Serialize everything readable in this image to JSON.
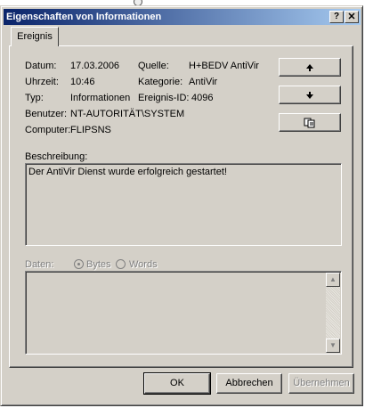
{
  "window": {
    "title": "Eigenschaften von Informationen",
    "help_glyph": "?",
    "close_glyph": "✕"
  },
  "tab": {
    "label": "Ereignis"
  },
  "fields": {
    "datum_label": "Datum:",
    "datum_value": "17.03.2006",
    "quelle_label": "Quelle:",
    "quelle_value": "H+BEDV AntiVir",
    "uhrzeit_label": "Uhrzeit:",
    "uhrzeit_value": "10:46",
    "kategorie_label": "Kategorie:",
    "kategorie_value": "AntiVir",
    "typ_label": "Typ:",
    "typ_value": "Informationen",
    "ereignis_id_label": "Ereignis-ID:",
    "ereignis_id_value": "4096",
    "benutzer_label": "Benutzer:",
    "benutzer_value": "NT-AUTORITÄT\\SYSTEM",
    "computer_label": "Computer:",
    "computer_value": "FLIPSNS"
  },
  "nav": {
    "up_icon": "arrow-up-icon",
    "down_icon": "arrow-down-icon",
    "copy_icon": "copy-icon"
  },
  "beschreibung": {
    "label": "Beschreibung:",
    "text": "Der AntiVir Dienst wurde erfolgreich gestartet!"
  },
  "daten": {
    "label": "Daten:",
    "bytes_label": "Bytes",
    "words_label": "Words",
    "selected": "Bytes",
    "content": ""
  },
  "buttons": {
    "ok": "OK",
    "cancel": "Abbrechen",
    "apply": "Übernehmen"
  },
  "colors": {
    "face": "#d4d0c8",
    "title_start": "#0a246a",
    "title_end": "#a6caf0",
    "disabled_text": "#808080"
  }
}
